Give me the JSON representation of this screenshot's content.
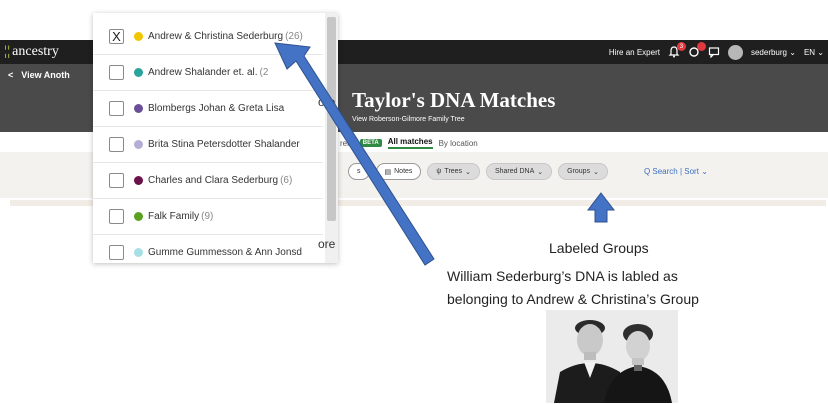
{
  "header": {
    "logo": "ancestry",
    "hire_expert": "Hire an Expert",
    "bell_badge": "3",
    "username": "sederburg",
    "username_chevron": "⌄",
    "language": "EN",
    "language_chevron": "⌄",
    "back_arrow": "<",
    "back_label": "View Anoth"
  },
  "page": {
    "title_prefix": "ore",
    "title": "Taylor's DNA Matches",
    "tree_link": "View Roberson-Gilmore Family Tree"
  },
  "tabs": {
    "partial": "rent",
    "beta": "BETA",
    "all_matches": "All matches",
    "by_location": "By location"
  },
  "filters": {
    "partial": "s",
    "notes": "Notes",
    "trees": "Trees",
    "shared_dna": "Shared DNA",
    "groups": "Groups",
    "search_sort": "Q Search | Sort",
    "chevron": "⌄"
  },
  "dropdown": {
    "edge_fragments": [
      "ore",
      "ore"
    ],
    "items": [
      {
        "checked_mark": "X",
        "name": "Andrew & Christina Sederburg",
        "count": "(26)",
        "color": "#f2c500"
      },
      {
        "checked_mark": "",
        "name": "Andrew Shalander et. al.",
        "count": "(2",
        "color": "#2aa39b"
      },
      {
        "checked_mark": "",
        "name": "Blombergs Johan & Greta Lisa",
        "count": "",
        "color": "#6b4f98"
      },
      {
        "checked_mark": "",
        "name": "Brita Stina Petersdotter Shalander",
        "count": "",
        "color": "#b6add6"
      },
      {
        "checked_mark": "",
        "name": "Charles and Clara Sederburg",
        "count": "(6)",
        "color": "#6a1249"
      },
      {
        "checked_mark": "",
        "name": "Falk Family",
        "count": "(9)",
        "color": "#5ba11f"
      },
      {
        "checked_mark": "",
        "name": "Gumme Gummesson & Ann Jonsd",
        "count": "",
        "color": "#a6dfe4"
      }
    ]
  },
  "annotations": {
    "labeled_groups": "Labeled Groups",
    "caption_line1": "William Sederburg’s DNA is labled  as",
    "caption_line2": "belonging to Andrew & Christina’s Group",
    "arrow_color": "#4472c4"
  }
}
